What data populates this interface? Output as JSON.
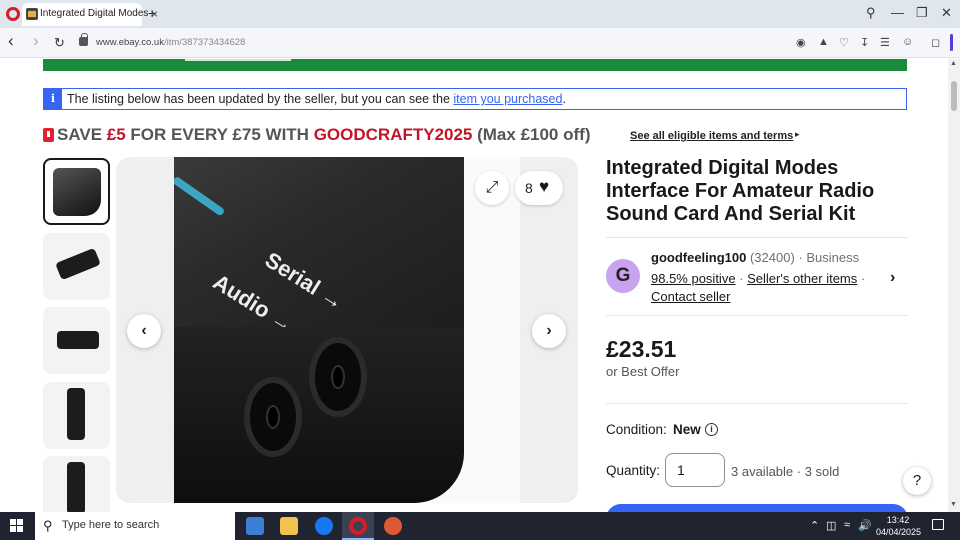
{
  "browser": {
    "tab_title": "Integrated Digital Modes",
    "tab_close": "×",
    "new_tab": "+",
    "url_host": "www.ebay.co.uk",
    "url_path": "/itm/387373434628",
    "minimize": "—",
    "maximize": "❐",
    "close": "✕",
    "back": "‹",
    "forward": "›",
    "reload": "↻"
  },
  "notice": {
    "icon": "i",
    "text_before": "The listing below has been updated by the seller, but you can see the ",
    "link": "item you purchased",
    "text_after": "."
  },
  "promo": {
    "save": "SAVE ",
    "amount": "£5",
    "middle": " FOR EVERY £75 WITH ",
    "code": "GOODCRAFTY2025",
    "max": " (Max £100 off)",
    "link": "See all eligible items and terms",
    "link_arrow": "▸"
  },
  "gallery": {
    "photo_label_serial": "Serial →",
    "photo_label_audio": "Audio →",
    "watch_count": "8",
    "heart": "♥",
    "expand": "⤢",
    "prev": "‹",
    "next": "›"
  },
  "listing": {
    "title": "Integrated Digital Modes Interface For Amateur Radio Sound Card And Serial Kit",
    "seller": {
      "avatar_letter": "G",
      "name": "goodfeeling100",
      "meta": " (32400) · Business",
      "positive": "98.5% positive",
      "sep": " · ",
      "other_items": "Seller's other items",
      "sep2": " ·",
      "contact": "Contact seller",
      "chevron": "›"
    },
    "price": "£23.51",
    "best_offer": "or Best Offer",
    "condition_label": "Condition:",
    "condition_value": "New",
    "condition_info": "i",
    "quantity_label": "Quantity:",
    "quantity_value": "1",
    "available": "3 available · 3 sold"
  },
  "help": "?",
  "taskbar": {
    "search_placeholder": "Type here to search",
    "search_icon": "⚲",
    "time": "13:42",
    "date": "04/04/2025",
    "tray_up": "⌃",
    "tray_volume": "🔊"
  },
  "colors": {
    "ebay_blue": "#3665f3",
    "promo_red": "#c0152a",
    "banner_green": "#1b8a3a",
    "avatar_purple": "#c9a3ef"
  }
}
